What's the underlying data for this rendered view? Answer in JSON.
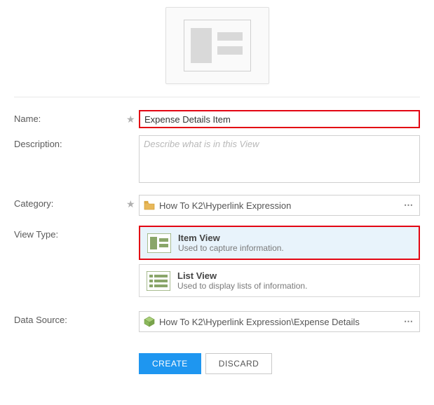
{
  "labels": {
    "name": "Name:",
    "description": "Description:",
    "category": "Category:",
    "viewType": "View Type:",
    "dataSource": "Data Source:"
  },
  "fields": {
    "name": "Expense Details Item",
    "descriptionPlaceholder": "Describe what is in this View",
    "category": "How To K2\\Hyperlink Expression",
    "dataSource": "How To K2\\Hyperlink Expression\\Expense Details"
  },
  "viewTypes": {
    "item": {
      "title": "Item View",
      "sub": "Used to capture information."
    },
    "list": {
      "title": "List View",
      "sub": "Used to display lists of information."
    }
  },
  "buttons": {
    "create": "CREATE",
    "discard": "DISCARD"
  },
  "icons": {
    "folder": "folder-icon",
    "cube": "cube-icon",
    "more": "⋯"
  }
}
